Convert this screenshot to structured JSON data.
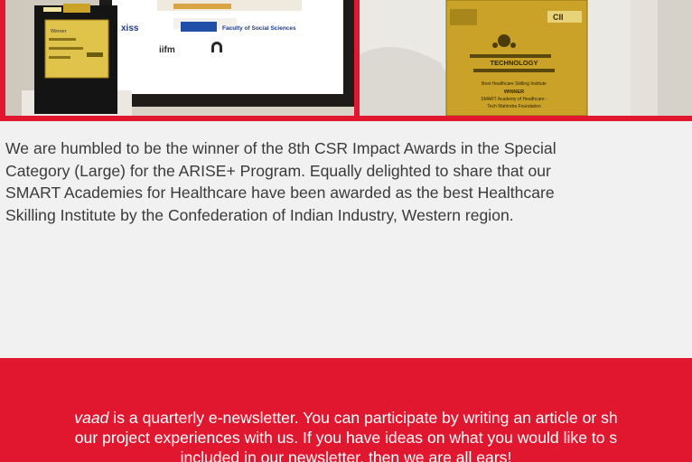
{
  "awards": {
    "left_photo": {
      "trophy_plaque": "Winner",
      "logos": [
        "xiss",
        "Faculty of Social Sciences",
        "iifm"
      ]
    },
    "right_photo": {
      "trophy_heading": "TECHNOLOGY",
      "trophy_line1": "Best Healthcare Skilling Institute",
      "trophy_winner": "WINNER",
      "trophy_line2": "SMART Academy of Healthcare -",
      "trophy_line3": "Tech Mahindra Foundation",
      "trophy_badge": "CII"
    }
  },
  "caption": {
    "lines": [
      "We are humbled to be the winner of the 8th CSR Impact Awards in the Special",
      "Category (Large) for the ARISE+ Program. Equally delighted to share that our",
      "SMART Academies for Healthcare have been awarded as the best Healthcare",
      "Skilling Institute by the Confederation of Indian Industry, Western region."
    ]
  },
  "footer": {
    "brand_fragment": "vaad",
    "line1_rest": " is a quarterly e-newsletter. You can participate by writing an article or sh",
    "line2": "our project experiences with us. If you have ideas on what you would like to s",
    "line3": "included in our newsletter, then we are all ears!"
  },
  "colors": {
    "accent_red": "#e0172f",
    "page_bg": "#f1f1f1",
    "body_text": "#3a3a3a",
    "trophy_gold": "#c9a227"
  }
}
